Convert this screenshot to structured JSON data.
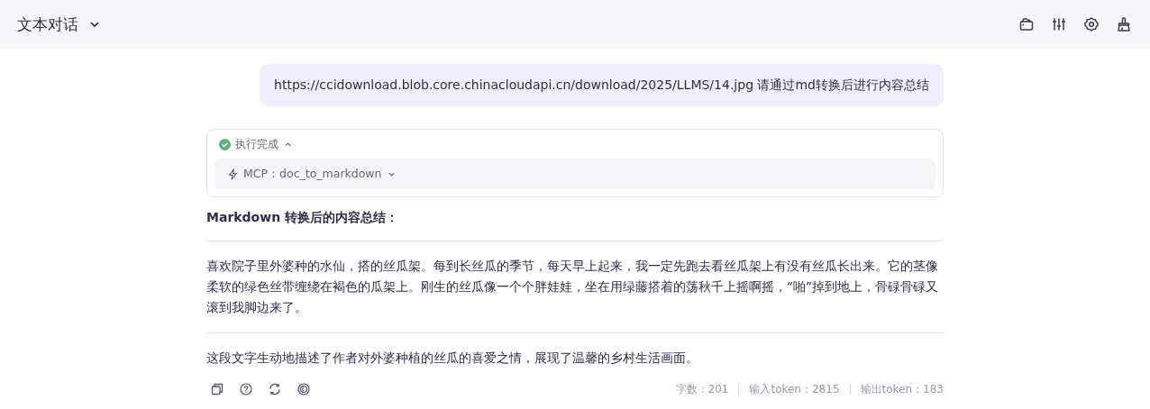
{
  "header": {
    "title": "文本对话"
  },
  "user_message": {
    "text": "https://ccidownload.blob.core.chinacloudapi.cn/download/2025/LLMS/14.jpg 请通过md转换后进行内容总结"
  },
  "tool_call": {
    "status": "执行完成",
    "expanded": true,
    "tool": {
      "label": "MCP：doc_to_markdown",
      "expanded": false
    }
  },
  "answer": {
    "heading": "Markdown 转换后的内容总结：",
    "quote": "喜欢院子里外婆种的水仙，搭的丝瓜架。每到长丝瓜的季节，每天早上起来，我一定先跑去看丝瓜架上有没有丝瓜长出来。它的茎像柔软的绿色丝带缠绕在褐色的瓜架上。刚生的丝瓜像一个个胖娃娃，坐在用绿藤搭着的荡秋千上摇啊摇，“啪”掉到地上，骨碌骨碌又滚到我脚边来了。",
    "summary": "这段文字生动地描述了作者对外婆种植的丝瓜的喜爱之情，展现了温馨的乡村生活画面。"
  },
  "stats": [
    "字数：201",
    "输入token：2815",
    "输出token：183"
  ]
}
